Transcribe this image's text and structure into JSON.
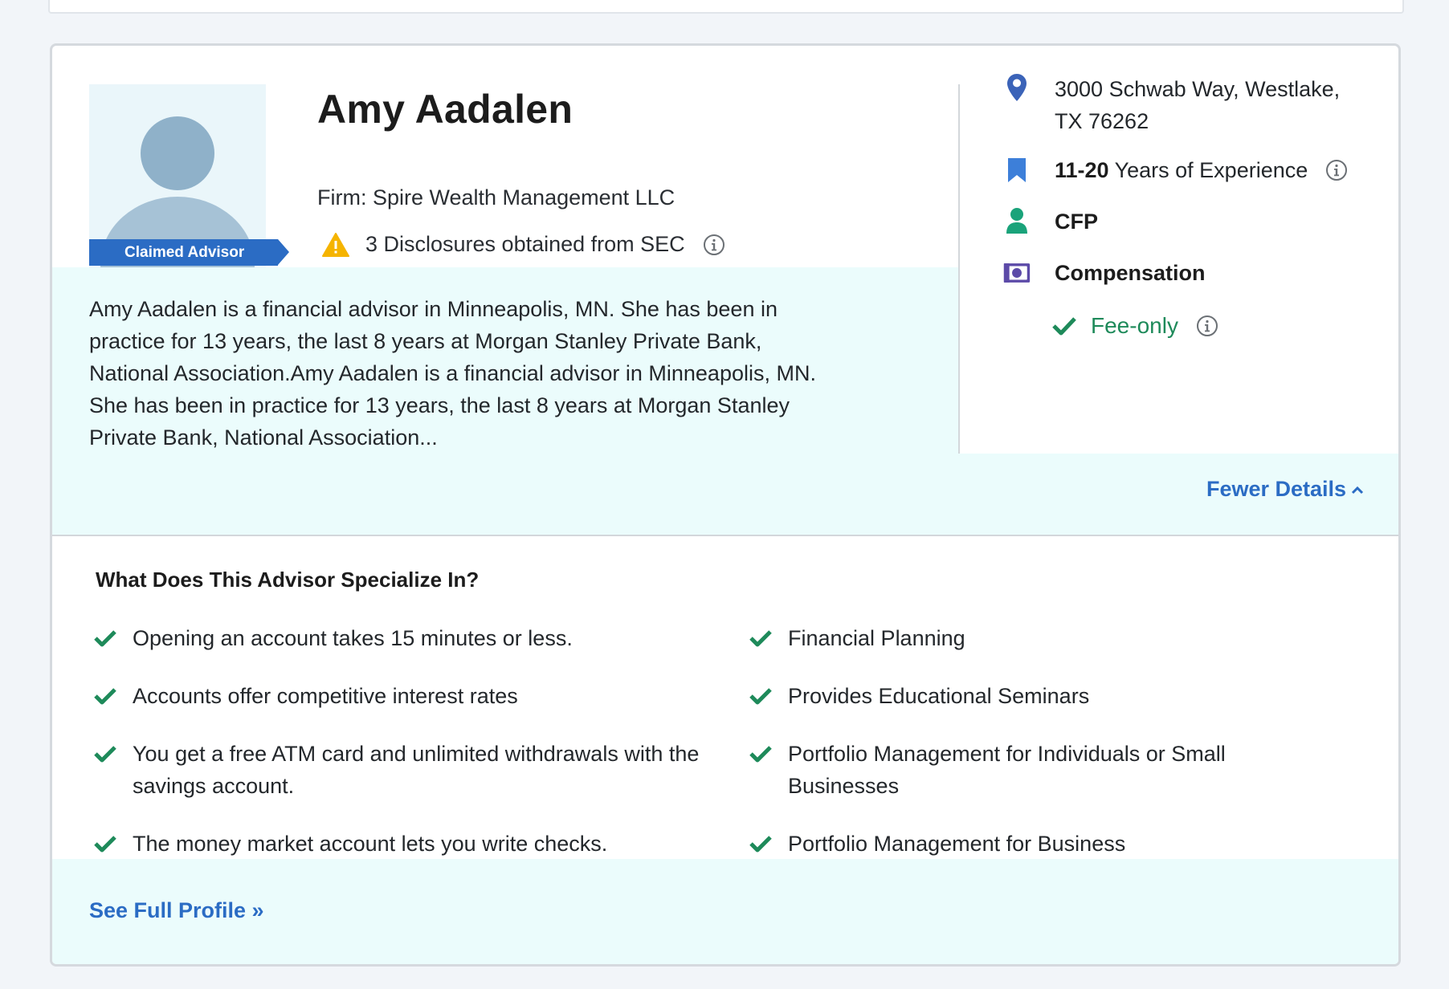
{
  "advisor": {
    "name": "Amy Aadalen",
    "badge": "Claimed Advisor",
    "firm": "Firm: Spire Wealth Management LLC",
    "disclosures": "3 Disclosures obtained from SEC",
    "bio": "Amy Aadalen is a financial advisor in Minneapolis, MN. She has been in practice for 13 years, the last 8 years at Morgan Stanley Private Bank, National Association.Amy Aadalen is a financial advisor in Minneapolis, MN. She has been in practice for 13 years, the last 8 years at Morgan Stanley Private Bank, National Association..."
  },
  "sidebar": {
    "address_line1": "3000 Schwab Way, Westlake,",
    "address_line2": "TX 76262",
    "experience_bold": "11-20",
    "experience_rest": " Years of Experience",
    "certification": "CFP",
    "compensation_label": "Compensation",
    "compensation_type": "Fee-only"
  },
  "links": {
    "fewer_details": "Fewer Details",
    "see_full_profile": "See Full Profile »"
  },
  "specialties": {
    "title": "What Does This Advisor Specialize In?",
    "left": [
      "Opening an account takes 15 minutes or less.",
      "Accounts offer competitive interest rates",
      "You get a free ATM card and unlimited withdrawals with the savings account.",
      "The money market account lets you write checks."
    ],
    "right": [
      "Financial Planning",
      "Provides Educational Seminars",
      "Portfolio Management for Individuals or Small Businesses",
      "Portfolio Management for Business"
    ]
  },
  "colors": {
    "accent_blue": "#2b6cc4",
    "check_green": "#1e8a5a",
    "warning_yellow": "#f5b400",
    "tint_bg": "#ebfcfc",
    "comp_purple": "#5c4aa8"
  },
  "icons": [
    "location-pin-icon",
    "bookmark-icon",
    "person-icon",
    "money-icon",
    "warning-icon",
    "info-icon",
    "check-icon",
    "chevron-up-icon"
  ]
}
